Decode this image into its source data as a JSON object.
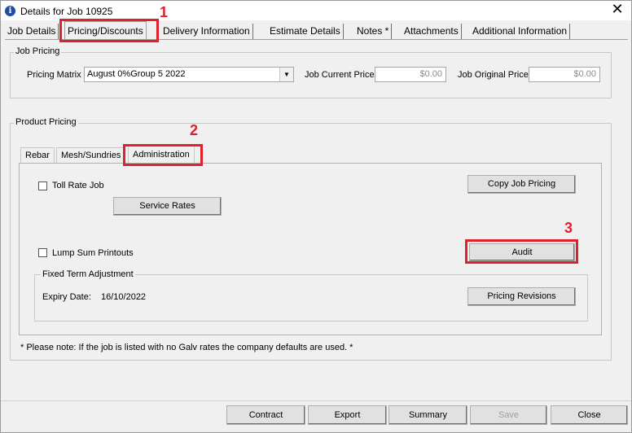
{
  "window": {
    "title": "Details for Job 10925",
    "close_glyph": "✕",
    "title_icon_glyph": "i"
  },
  "tabs": [
    {
      "label": "Job Details"
    },
    {
      "label": "Pricing/Discounts"
    },
    {
      "label": "Delivery Information"
    },
    {
      "label": "Estimate Details"
    },
    {
      "label": "Notes *"
    },
    {
      "label": "Attachments"
    },
    {
      "label": "Additional Information"
    }
  ],
  "job_pricing": {
    "group_label": "Job Pricing",
    "matrix_label": "Pricing Matrix",
    "matrix_value": "August 0%Group 5 2022",
    "matrix_dropdown_glyph": "▼",
    "current_price_label": "Job Current Price",
    "current_price_value": "$0.00",
    "original_price_label": "Job Original Price",
    "original_price_value": "$0.00"
  },
  "product_pricing": {
    "group_label": "Product Pricing",
    "tabs": [
      {
        "label": "Rebar"
      },
      {
        "label": "Mesh/Sundries"
      },
      {
        "label": "Administration"
      }
    ],
    "toll_rate_label": "Toll Rate Job",
    "copy_job_pricing_label": "Copy Job Pricing",
    "service_rates_label": "Service Rates",
    "lump_sum_label": "Lump Sum Printouts",
    "audit_label": "Audit",
    "fixed_term": {
      "group_label": "Fixed Term Adjustment",
      "expiry_label": "Expiry Date:",
      "expiry_value": "16/10/2022",
      "pricing_revisions_label": "Pricing Revisions"
    },
    "note": "* Please note: If the job is listed with no Galv rates the company defaults are used. *"
  },
  "footer": {
    "contract_label": "Contract",
    "export_label": "Export",
    "summary_label": "Summary",
    "save_label": "Save",
    "close_label": "Close"
  },
  "annotations": {
    "marker_1": "1",
    "marker_2": "2",
    "marker_3": "3",
    "color": "#e0202b"
  }
}
